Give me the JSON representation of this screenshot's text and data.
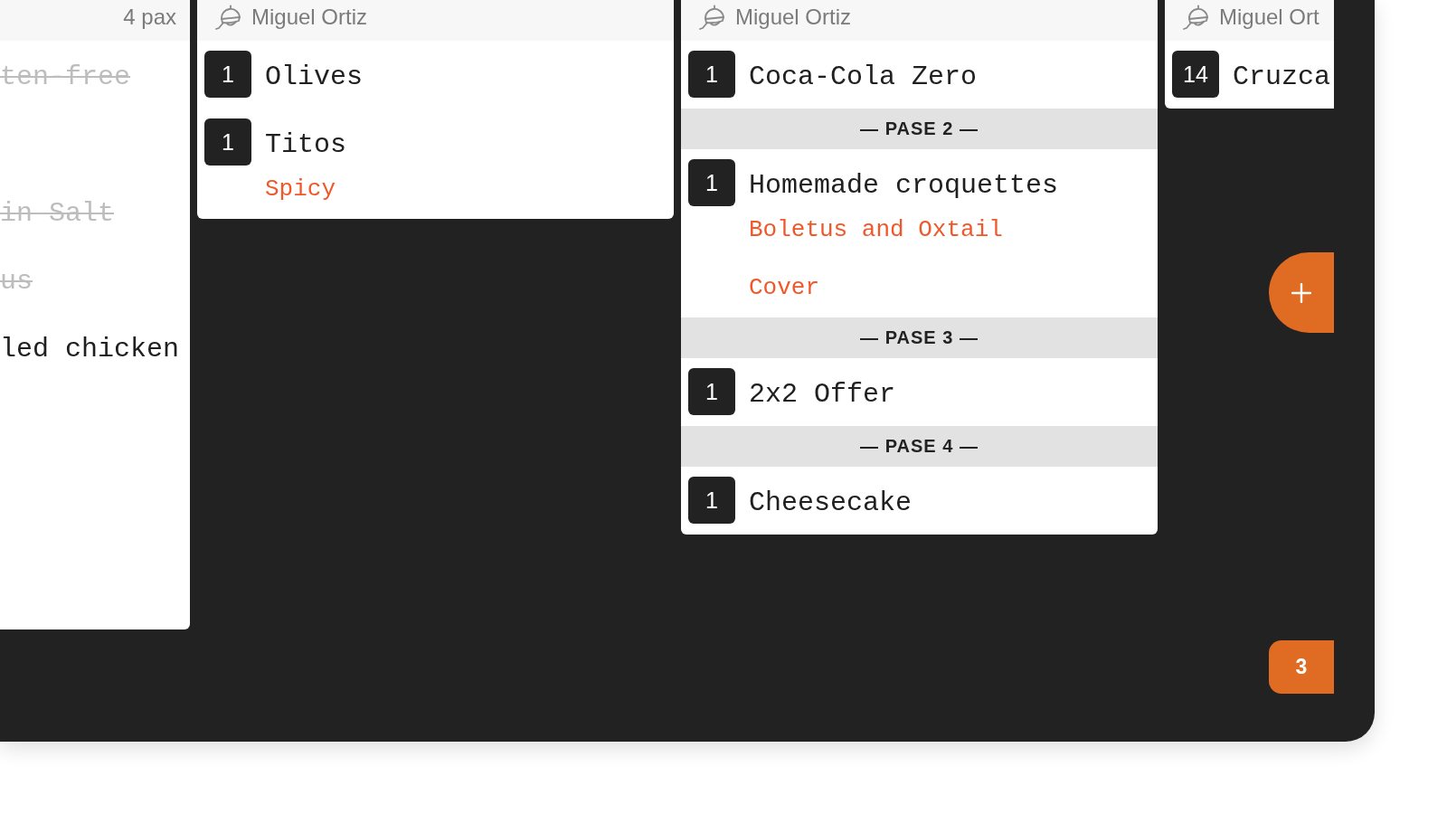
{
  "tickets": [
    {
      "pax": "4 pax",
      "sections": [
        {
          "items": [
            {
              "name": "ten-free",
              "struck": true
            },
            {
              "name": "in Salt",
              "struck": true
            },
            {
              "name": "us",
              "struck": true
            },
            {
              "name": "led chicken",
              "struck": false
            }
          ]
        }
      ]
    },
    {
      "waiter": "Miguel Ortiz",
      "sections": [
        {
          "items": [
            {
              "qty": "1",
              "name": "Olives",
              "struck": false
            },
            {
              "qty": "1",
              "name": "Titos",
              "struck": false,
              "modifiers": [
                "Spicy"
              ]
            }
          ]
        }
      ]
    },
    {
      "waiter": "Miguel Ortiz",
      "sections": [
        {
          "items": [
            {
              "qty": "1",
              "name": "Coca-Cola Zero",
              "struck": false
            }
          ]
        },
        {
          "course": "— PASE 2 —",
          "items": [
            {
              "qty": "1",
              "name": "Homemade croquettes",
              "struck": false,
              "modifiers": [
                "Boletus and Oxtail",
                "Cover"
              ]
            }
          ]
        },
        {
          "course": "— PASE 3 —",
          "items": [
            {
              "qty": "1",
              "name": "2x2 Offer",
              "struck": false
            }
          ]
        },
        {
          "course": "— PASE 4 —",
          "items": [
            {
              "qty": "1",
              "name": "Cheesecake",
              "struck": false
            }
          ]
        }
      ]
    },
    {
      "waiter": "Miguel Ort",
      "sections": [
        {
          "items": [
            {
              "qty": "14",
              "name": "Cruzca",
              "struck": false
            }
          ]
        }
      ]
    }
  ],
  "counter": "3"
}
